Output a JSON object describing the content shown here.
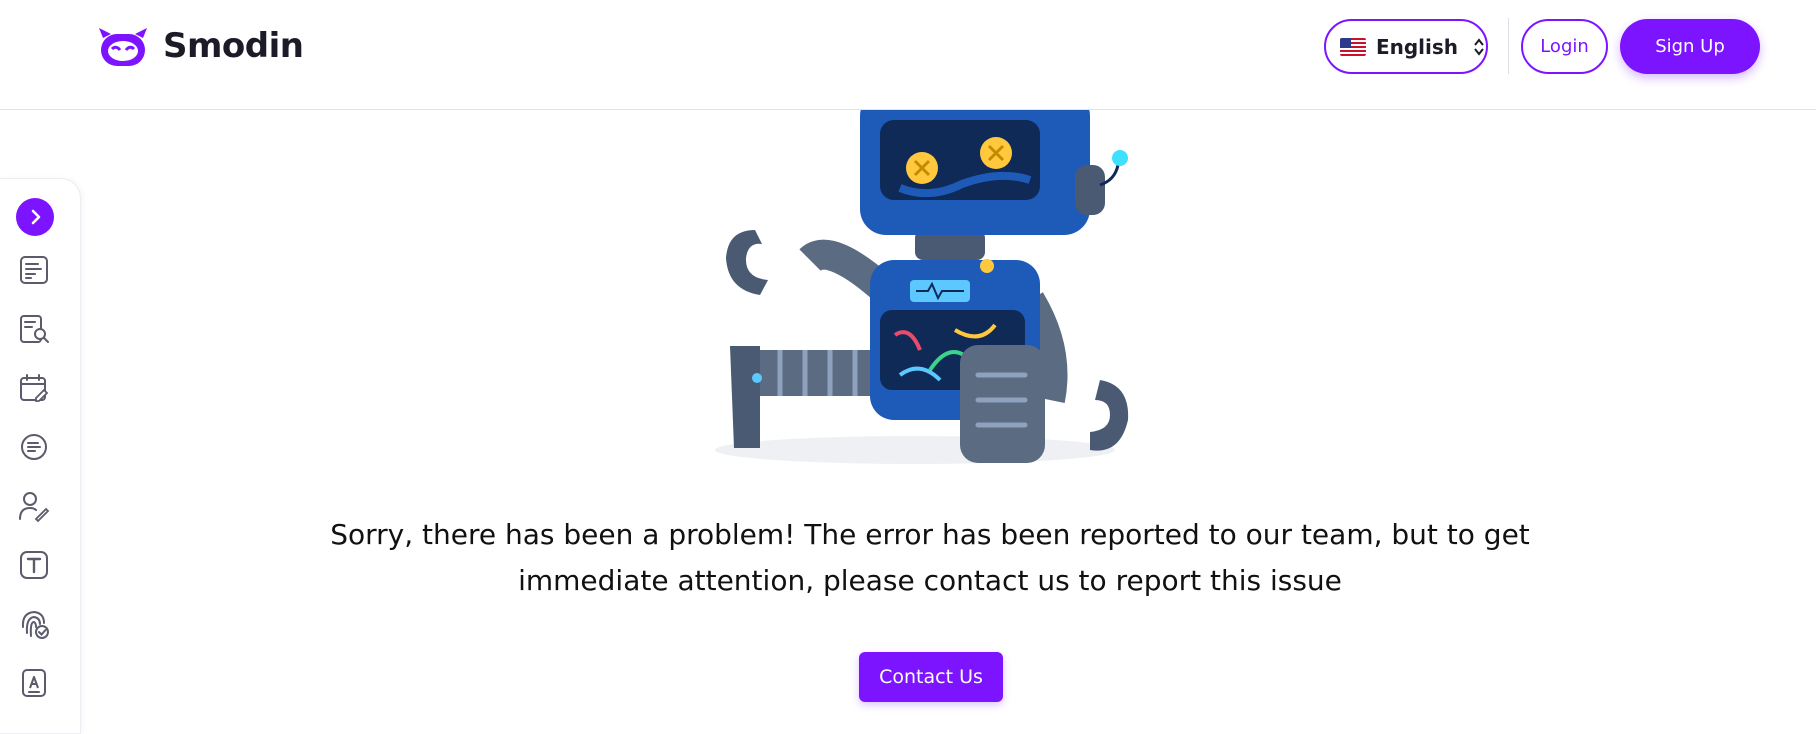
{
  "header": {
    "brand_name": "Smodin",
    "language": {
      "label": "English",
      "flag": "us-flag-icon"
    },
    "login_label": "Login",
    "signup_label": "Sign Up"
  },
  "sidebar": {
    "toggle_icon": "chevron-right-icon",
    "items": [
      {
        "icon": "document-lines-icon"
      },
      {
        "icon": "document-search-icon"
      },
      {
        "icon": "calendar-edit-icon"
      },
      {
        "icon": "summary-circle-icon"
      },
      {
        "icon": "user-pen-icon"
      },
      {
        "icon": "text-t-icon"
      },
      {
        "icon": "fingerprint-check-icon"
      },
      {
        "icon": "document-a-icon"
      }
    ]
  },
  "main": {
    "illustration": "broken-robot-illustration",
    "message": "Sorry, there has been a problem! The error has been reported to our team, but to get immediate attention, please contact us to report this issue",
    "contact_label": "Contact Us"
  },
  "colors": {
    "accent": "#7c14ff",
    "text": "#111111",
    "robot_blue": "#1e5bb8",
    "robot_gray": "#5b6b82"
  }
}
